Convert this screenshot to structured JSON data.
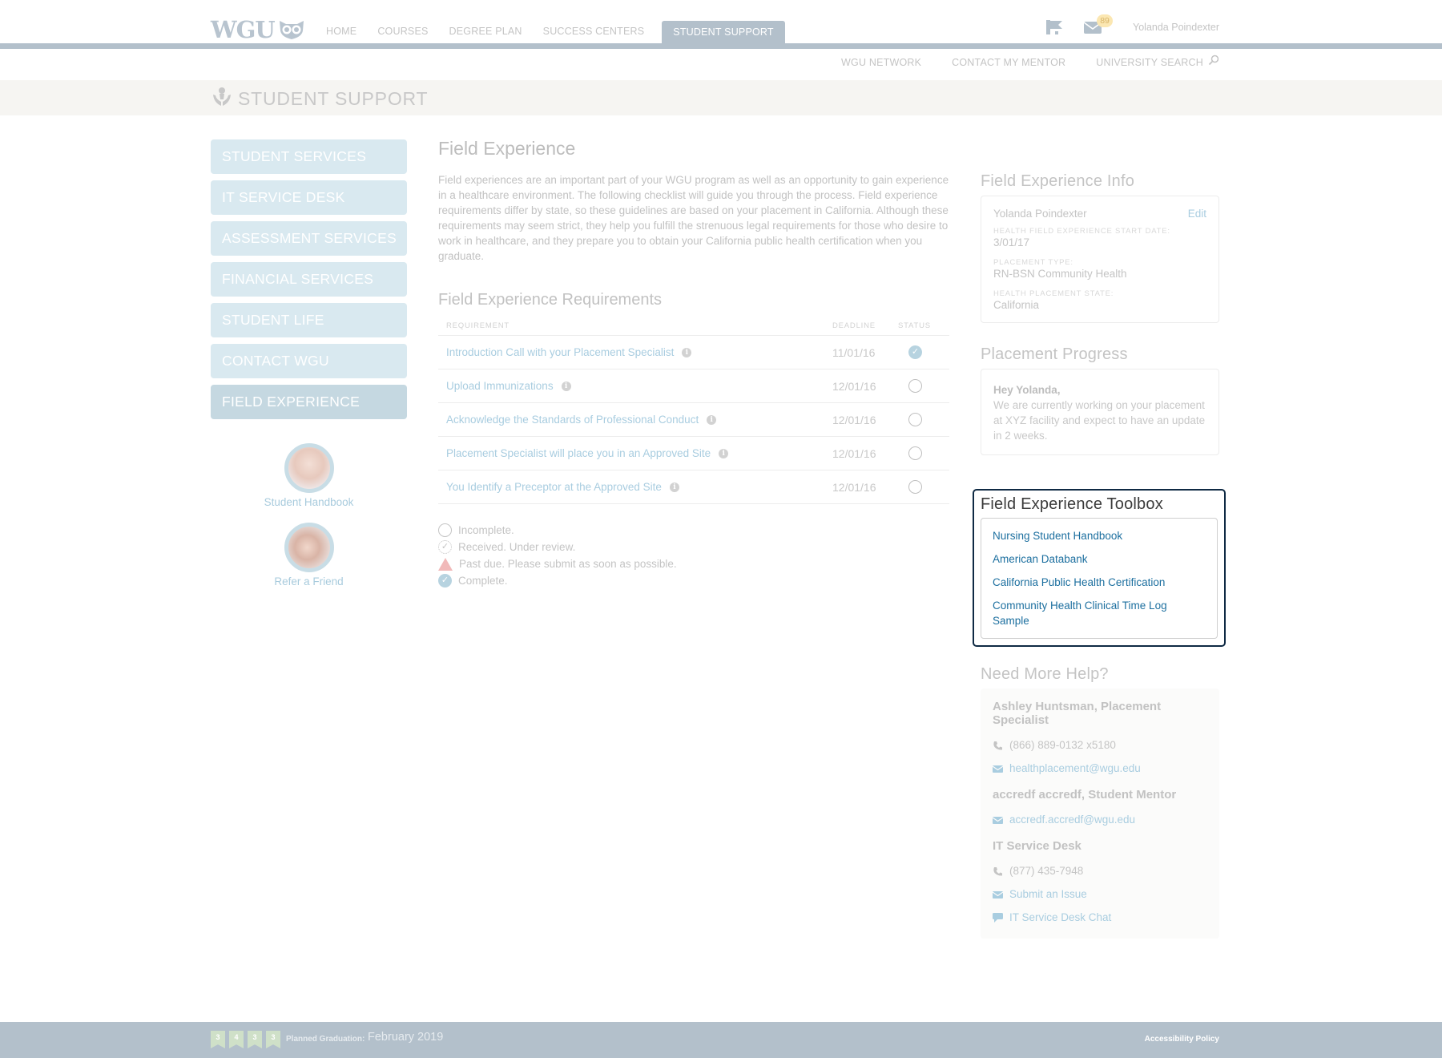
{
  "header": {
    "logo_text": "WGU",
    "nav": [
      {
        "label": "HOME",
        "active": false
      },
      {
        "label": "COURSES",
        "active": false
      },
      {
        "label": "DEGREE PLAN",
        "active": false
      },
      {
        "label": "SUCCESS CENTERS",
        "active": false
      },
      {
        "label": "STUDENT SUPPORT",
        "active": true
      }
    ],
    "notification_count": "89",
    "user_name": "Yolanda Poindexter",
    "icons": {
      "announcements": "megaphone-icon",
      "messages": "envelope-icon",
      "search": "magnifier-icon"
    }
  },
  "subnav": {
    "items": [
      "WGU NETWORK",
      "CONTACT MY MENTOR"
    ],
    "search_label": "UNIVERSITY SEARCH"
  },
  "banner": {
    "title": "STUDENT SUPPORT",
    "icon": "hands-person-icon"
  },
  "sidebar": {
    "items": [
      {
        "label": "STUDENT SERVICES",
        "active": false
      },
      {
        "label": "IT SERVICE DESK",
        "active": false
      },
      {
        "label": "ASSESSMENT SERVICES",
        "active": false
      },
      {
        "label": "FINANCIAL SERVICES",
        "active": false
      },
      {
        "label": "STUDENT LIFE",
        "active": false
      },
      {
        "label": "CONTACT WGU",
        "active": false
      },
      {
        "label": "FIELD EXPERIENCE",
        "active": true
      }
    ],
    "cards": [
      {
        "label": "Student Handbook"
      },
      {
        "label": "Refer a Friend"
      }
    ]
  },
  "main": {
    "title": "Field Experience",
    "intro": "Field experiences are an important part of your WGU program as well as an opportunity to gain experience in a healthcare environment. The following checklist will guide you through the process. Field experience requirements differ by state, so these guidelines are based on your placement in California. Although these requirements may seem strict, they help you fulfill the strenuous legal requirements for those who desire to work in healthcare, and they prepare you to obtain your California public health certification when you graduate.",
    "requirements_title": "Field Experience Requirements",
    "columns": {
      "requirement": "REQUIREMENT",
      "deadline": "DEADLINE",
      "status": "STATUS"
    },
    "requirements": [
      {
        "name": "Introduction Call with your Placement Specialist",
        "deadline": "11/01/16",
        "status": "complete"
      },
      {
        "name": "Upload Immunizations",
        "deadline": "12/01/16",
        "status": "incomplete"
      },
      {
        "name": "Acknowledge the Standards of Professional Conduct",
        "deadline": "12/01/16",
        "status": "incomplete"
      },
      {
        "name": "Placement Specialist will place you in an Approved Site",
        "deadline": "12/01/16",
        "status": "incomplete"
      },
      {
        "name": "You Identify a Preceptor at the Approved Site",
        "deadline": "12/01/16",
        "status": "incomplete"
      }
    ],
    "legend": [
      {
        "icon": "empty-circle-icon",
        "label": "Incomplete."
      },
      {
        "icon": "dotted-check-circle-icon",
        "label": "Received. Under review."
      },
      {
        "icon": "warning-triangle-icon",
        "label": "Past due. Please submit as soon as possible."
      },
      {
        "icon": "check-circle-icon",
        "label": "Complete."
      }
    ]
  },
  "info": {
    "title": "Field Experience Info",
    "name": "Yolanda Poindexter",
    "edit_label": "Edit",
    "fields": [
      {
        "label": "HEALTH FIELD EXPERIENCE START DATE:",
        "value": "3/01/17"
      },
      {
        "label": "PLACEMENT TYPE:",
        "value": "RN-BSN Community Health"
      },
      {
        "label": "HEALTH PLACEMENT STATE:",
        "value": "California"
      }
    ]
  },
  "progress": {
    "title": "Placement Progress",
    "greeting": "Hey Yolanda,",
    "message": "We are currently working on your placement at XYZ facility and expect to have an update in 2 weeks."
  },
  "toolbox": {
    "title": "Field Experience Toolbox",
    "links": [
      "Nursing Student Handbook",
      "American Databank",
      "California Public Health Certification",
      "Community Health Clinical Time Log Sample"
    ]
  },
  "help": {
    "title": "Need More Help?",
    "contacts": [
      {
        "name": "Ashley Huntsman, Placement Specialist",
        "phone": "(866) 889-0132 x5180",
        "email": "healthplacement@wgu.edu"
      },
      {
        "name": "accredf accredf, Student Mentor",
        "email": "accredf.accredf@wgu.edu"
      },
      {
        "name": "IT Service Desk",
        "phone": "(877) 435-7948",
        "link1": "Submit an Issue",
        "link2": "IT Service Desk Chat"
      }
    ]
  },
  "footer": {
    "ribbons": [
      "3",
      "4",
      "3",
      "3"
    ],
    "graduation_label": "Planned Graduation:",
    "graduation_value": "February 2019",
    "accessibility": "Accessibility Policy"
  },
  "colors": {
    "nav_active": "#b3c0cb",
    "sidebar_item": "#d9e9f0",
    "sidebar_active": "#c5d8e1",
    "link": "#a9cde0",
    "toolbox_link": "#1c6f9f",
    "toolbox_border": "#0f2a44",
    "badge": "#fbe7b2",
    "ribbon": "#cfe0c8"
  }
}
